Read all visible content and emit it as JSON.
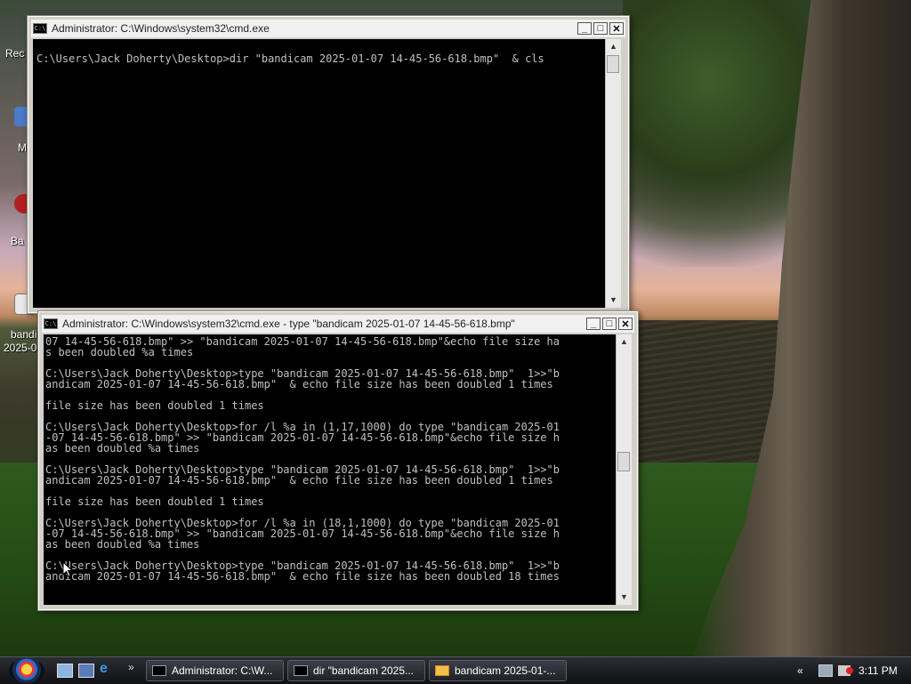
{
  "desktop": {
    "icons": [
      {
        "label": "Rec"
      },
      {
        "label": "M"
      },
      {
        "label": "Ba"
      },
      {
        "label": "bandi"
      },
      {
        "label": "2025-0"
      }
    ]
  },
  "window1": {
    "title": "Administrator: C:\\Windows\\system32\\cmd.exe",
    "lines": [
      "C:\\Users\\Jack Doherty\\Desktop>dir \"bandicam 2025-01-07 14-45-56-618.bmp\"  & cls"
    ]
  },
  "window2": {
    "title": "Administrator: C:\\Windows\\system32\\cmd.exe - type  \"bandicam 2025-01-07 14-45-56-618.bmp\"",
    "lines": [
      "07 14-45-56-618.bmp\" >> \"bandicam 2025-01-07 14-45-56-618.bmp\"&echo file size ha",
      "s been doubled %a times",
      "",
      "C:\\Users\\Jack Doherty\\Desktop>type \"bandicam 2025-01-07 14-45-56-618.bmp\"  1>>\"b",
      "andicam 2025-01-07 14-45-56-618.bmp\"  & echo file size has been doubled 1 times",
      "",
      "file size has been doubled 1 times",
      "",
      "C:\\Users\\Jack Doherty\\Desktop>for /l %a in (1,17,1000) do type \"bandicam 2025-01",
      "-07 14-45-56-618.bmp\" >> \"bandicam 2025-01-07 14-45-56-618.bmp\"&echo file size h",
      "as been doubled %a times",
      "",
      "C:\\Users\\Jack Doherty\\Desktop>type \"bandicam 2025-01-07 14-45-56-618.bmp\"  1>>\"b",
      "andicam 2025-01-07 14-45-56-618.bmp\"  & echo file size has been doubled 1 times",
      "",
      "file size has been doubled 1 times",
      "",
      "C:\\Users\\Jack Doherty\\Desktop>for /l %a in (18,1,1000) do type \"bandicam 2025-01",
      "-07 14-45-56-618.bmp\" >> \"bandicam 2025-01-07 14-45-56-618.bmp\"&echo file size h",
      "as been doubled %a times",
      "",
      "C:\\Users\\Jack Doherty\\Desktop>type \"bandicam 2025-01-07 14-45-56-618.bmp\"  1>>\"b",
      "andicam 2025-01-07 14-45-56-618.bmp\"  & echo file size has been doubled 18 times"
    ]
  },
  "taskbar": {
    "buttons": [
      {
        "label": "Administrator: C:\\W..."
      },
      {
        "label": "dir  \"bandicam 2025..."
      },
      {
        "label": "bandicam 2025-01-..."
      }
    ],
    "clock": "3:11 PM",
    "chevron": "«"
  }
}
